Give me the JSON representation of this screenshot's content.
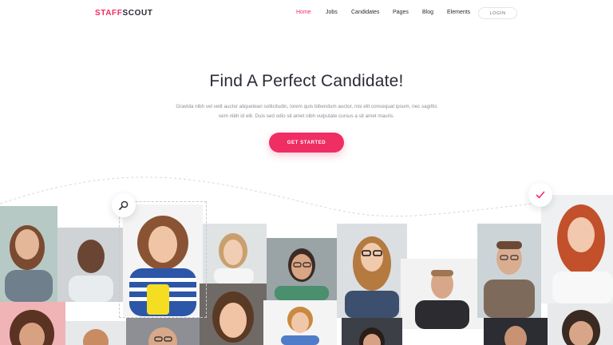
{
  "brand": {
    "part1": "STAFF",
    "part2": "SCOUT"
  },
  "nav": {
    "items": [
      {
        "label": "Home",
        "active": true
      },
      {
        "label": "Jobs"
      },
      {
        "label": "Candidates"
      },
      {
        "label": "Pages"
      },
      {
        "label": "Blog"
      },
      {
        "label": "Elements"
      }
    ],
    "login_label": "LOGIN"
  },
  "hero": {
    "title": "Find A Perfect Candidate!",
    "description": "Gravida nibh vel velit auctor aliquetean sollicitudin, lorem quis bibendum auctor, nisi elit consequat ipsum, nec sagittis sem nibh id elit. Duis sed odio sit amet nibh vulputate cursus a sit amet mauris.",
    "cta_label": "GET STARTED"
  },
  "colors": {
    "accent": "#ef2e63",
    "text": "#2b2b36",
    "muted": "#8c8c99"
  },
  "icons": {
    "search": "magnifier-icon",
    "check": "checkmark-icon"
  }
}
